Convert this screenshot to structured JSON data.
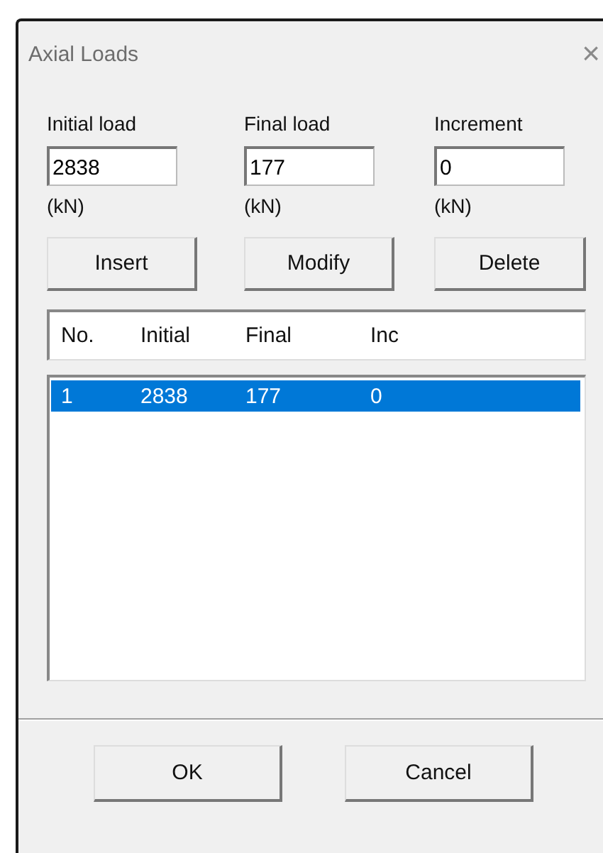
{
  "window": {
    "title": "Axial Loads",
    "close": "×"
  },
  "fields": [
    {
      "label": "Initial load",
      "value": "2838",
      "unit": "(kN)"
    },
    {
      "label": "Final load",
      "value": "177",
      "unit": "(kN)"
    },
    {
      "label": "Increment",
      "value": "0",
      "unit": "(kN)"
    }
  ],
  "actions": [
    "Insert",
    "Modify",
    "Delete"
  ],
  "list": {
    "columns": [
      "No.",
      "Initial",
      "Final",
      "Inc"
    ],
    "rows": [
      {
        "cells": [
          "1",
          "2838",
          "177",
          "0"
        ],
        "selected": true
      }
    ]
  },
  "buttons": [
    "OK",
    "Cancel"
  ]
}
